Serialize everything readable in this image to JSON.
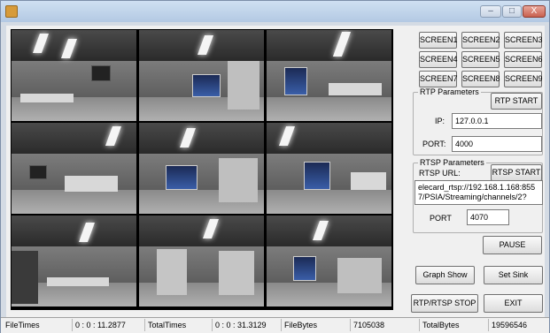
{
  "titlebar": {
    "minimize": "–",
    "maximize": "□",
    "close": "X"
  },
  "screens": [
    "SCREEN1",
    "SCREEN2",
    "SCREEN3",
    "SCREEN4",
    "SCREEN5",
    "SCREEN6",
    "SCREEN7",
    "SCREEN8",
    "SCREEN9"
  ],
  "rtp": {
    "group_title": "RTP Parameters",
    "start_label": "RTP START",
    "ip_label": "IP:",
    "ip_value": "127.0.0.1",
    "port_label": "PORT:",
    "port_value": "4000"
  },
  "rtsp": {
    "group_title": "RTSP Parameters",
    "url_label": "RTSP  URL:",
    "start_label": "RTSP START",
    "url_value": "elecard_rtsp://192.168.1.168:8557/PSIA/Streaming/channels/2?",
    "port_label": "PORT",
    "port_value": "4070"
  },
  "actions": {
    "pause": "PAUSE",
    "graph_show": "Graph Show",
    "set_sink": "Set Sink",
    "stop": "RTP/RTSP STOP",
    "exit": "EXIT"
  },
  "status": {
    "file_times_label": "FileTimes",
    "file_times_value": "0 : 0 : 11.2877",
    "total_times_label": "TotalTimes",
    "total_times_value": "0 : 0 : 31.3129",
    "file_bytes_label": "FileBytes",
    "file_bytes_value": "7105038",
    "total_bytes_label": "TotalBytes",
    "total_bytes_value": "19596546"
  }
}
